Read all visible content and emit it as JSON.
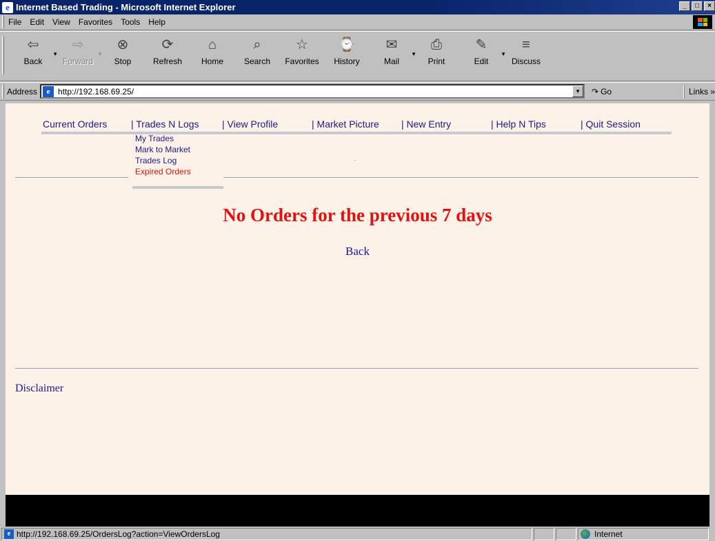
{
  "window": {
    "title": "Internet Based Trading - Microsoft Internet Explorer",
    "controls": [
      "_",
      "□",
      "×"
    ]
  },
  "menu": [
    "File",
    "Edit",
    "View",
    "Favorites",
    "Tools",
    "Help"
  ],
  "toolbar": [
    {
      "label": "Back",
      "icon": "back-arrow-icon",
      "glyph": "⇦",
      "enabled": true,
      "dropdown": true
    },
    {
      "label": "Forward",
      "icon": "forward-arrow-icon",
      "glyph": "⇨",
      "enabled": false,
      "dropdown": true
    },
    {
      "label": "Stop",
      "icon": "stop-icon",
      "glyph": "⊗",
      "enabled": true,
      "dropdown": false
    },
    {
      "label": "Refresh",
      "icon": "refresh-icon",
      "glyph": "⟳",
      "enabled": true,
      "dropdown": false
    },
    {
      "label": "Home",
      "icon": "home-icon",
      "glyph": "⌂",
      "enabled": true,
      "dropdown": false
    },
    {
      "label": "Search",
      "icon": "search-icon",
      "glyph": "⌕",
      "enabled": true,
      "dropdown": false
    },
    {
      "label": "Favorites",
      "icon": "favorites-icon",
      "glyph": "☆",
      "enabled": true,
      "dropdown": false
    },
    {
      "label": "History",
      "icon": "history-icon",
      "glyph": "⌚",
      "enabled": true,
      "dropdown": false
    },
    {
      "label": "Mail",
      "icon": "mail-icon",
      "glyph": "✉",
      "enabled": true,
      "dropdown": true
    },
    {
      "label": "Print",
      "icon": "print-icon",
      "glyph": "⎙",
      "enabled": true,
      "dropdown": false
    },
    {
      "label": "Edit",
      "icon": "edit-icon",
      "glyph": "✎",
      "enabled": true,
      "dropdown": true
    },
    {
      "label": "Discuss",
      "icon": "discuss-icon",
      "glyph": "≡",
      "enabled": true,
      "dropdown": false
    }
  ],
  "address": {
    "label": "Address",
    "url": "http://192.168.69.25/",
    "go_label": "Go",
    "links_label": "Links"
  },
  "nav": [
    {
      "label": "Current Orders"
    },
    {
      "label": "| Trades N Logs"
    },
    {
      "label": "| View Profile"
    },
    {
      "label": "| Market Picture"
    },
    {
      "label": "| New Entry"
    },
    {
      "label": "| Help N Tips"
    },
    {
      "label": "| Quit Session"
    }
  ],
  "submenu": [
    {
      "label": "My Trades",
      "active": false
    },
    {
      "label": "Mark to Market",
      "active": false
    },
    {
      "label": "Trades Log",
      "active": false
    },
    {
      "label": "Expired Orders",
      "active": true
    }
  ],
  "content": {
    "message": "No Orders for the previous 7 days",
    "back_label": "Back",
    "disclaimer": "Disclaimer"
  },
  "status": {
    "url": "http://192.168.69.25/OrdersLog?action=ViewOrdersLog",
    "zone": "Internet"
  },
  "colors": {
    "page_bg": "#fdf2e7",
    "link": "#1a1a8c",
    "alert": "#e51010",
    "titlebar": "#0a246a"
  }
}
